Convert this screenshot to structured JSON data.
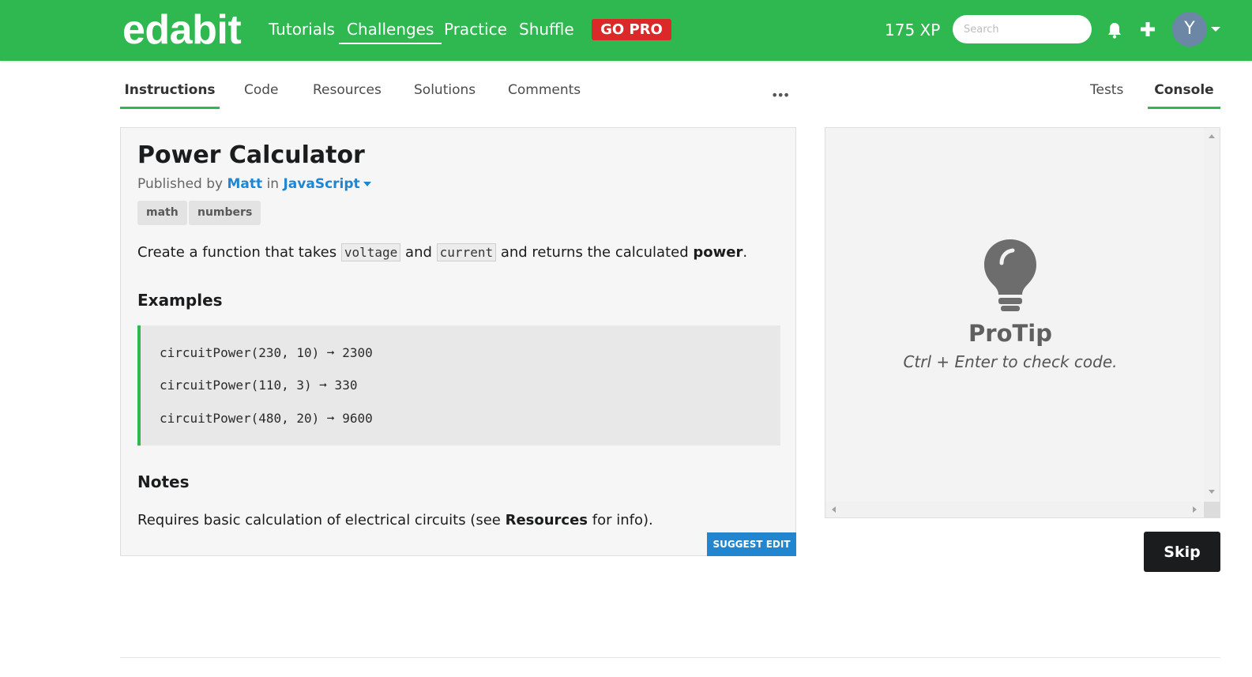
{
  "header": {
    "logo": "edabit",
    "nav": [
      "Tutorials",
      "Challenges",
      "Practice",
      "Shuffle"
    ],
    "active_nav": "Challenges",
    "gopro_label": "GO PRO",
    "xp": "175 XP",
    "search_placeholder": "Search",
    "avatar_initial": "Y",
    "colors": {
      "brand": "#2eb84f",
      "gopro": "#db2828"
    }
  },
  "tabs": {
    "left": [
      "Instructions",
      "Code",
      "Resources",
      "Solutions",
      "Comments"
    ],
    "right": [
      "Tests",
      "Console"
    ],
    "more": "•••"
  },
  "challenge": {
    "title": "Power Calculator",
    "published_by_prefix": "Published by",
    "author": "Matt",
    "in_word": "in",
    "language": "JavaScript",
    "tags": [
      "math",
      "numbers"
    ],
    "desc": {
      "part1": "Create a function that takes",
      "code1": "voltage",
      "and_word": "and",
      "code2": "current",
      "part2": "and returns the calculated",
      "bold": "power",
      "end": "."
    },
    "examples_heading": "Examples",
    "examples": [
      "circuitPower(230, 10) ➞ 2300",
      "circuitPower(110, 3) ➞ 330",
      "circuitPower(480, 20) ➞ 9600"
    ],
    "notes_heading": "Notes",
    "notes": {
      "part1": "Requires basic calculation of electrical circuits (see",
      "bold": "Resources",
      "part2": "for info)."
    },
    "suggest_edit": "SUGGEST EDIT"
  },
  "console": {
    "protip_title": "ProTip",
    "protip_text": "Ctrl + Enter to check code."
  },
  "skip_label": "Skip"
}
